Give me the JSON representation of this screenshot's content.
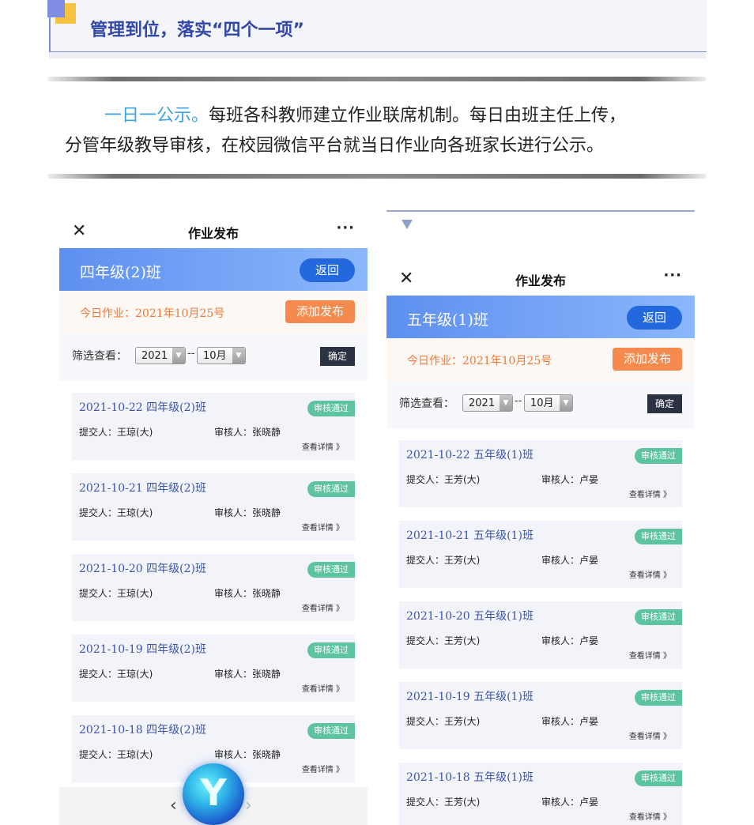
{
  "header": {
    "title": "管理到位，落实“四个一项”"
  },
  "intro": {
    "highlight": "一日一公示。",
    "line1_rest": "每班各科教师建立作业联席机制。每日由班主任上传，",
    "line2": "分管年级教导审核，在校园微信平台就当日作业向各班家长进行公示。"
  },
  "colors": {
    "accent_blue": "#3347a8",
    "class_bar": "#5d8ff0",
    "back_button": "#2368dc",
    "add_button": "#f48a4e",
    "approved_badge": "#5cc4a1"
  },
  "left_phone": {
    "close_icon": "✕",
    "title": "作业发布",
    "more_icon": "···",
    "class_name": "四年级(2)班",
    "back_label": "返回",
    "today": "今日作业：2021年10月25号",
    "add_label": "添加发布",
    "filter_label": "筛选查看：",
    "year": "2021",
    "dash": "--",
    "month": "10月",
    "confirm_label": "确定",
    "cards": [
      {
        "date": "2021-10-22 四年级(2)班",
        "status": "审核通过",
        "submitter": "提交人：王琼(大)",
        "reviewer": "审核人：张晓静",
        "detail": "查看详情 》"
      },
      {
        "date": "2021-10-21 四年级(2)班",
        "status": "审核通过",
        "submitter": "提交人：王琼(大)",
        "reviewer": "审核人：张晓静",
        "detail": "查看详情 》"
      },
      {
        "date": "2021-10-20 四年级(2)班",
        "status": "审核通过",
        "submitter": "提交人：王琼(大)",
        "reviewer": "审核人：张晓静",
        "detail": "查看详情 》"
      },
      {
        "date": "2021-10-19 四年级(2)班",
        "status": "审核通过",
        "submitter": "提交人：王琼(大)",
        "reviewer": "审核人：张晓静",
        "detail": "查看详情 》"
      },
      {
        "date": "2021-10-18 四年级(2)班",
        "status": "审核通过",
        "submitter": "提交人：王琼(大)",
        "reviewer": "审核人：张晓静",
        "detail": "查看详情 》"
      }
    ],
    "nav_prev": "‹",
    "nav_next": "›",
    "logo_glyph": "Y"
  },
  "right_phone": {
    "close_icon": "✕",
    "title": "作业发布",
    "more_icon": "···",
    "class_name": "五年级(1)班",
    "back_label": "返回",
    "today": "今日作业：2021年10月25号",
    "add_label": "添加发布",
    "filter_label": "筛选查看：",
    "year": "2021",
    "dash": "--",
    "month": "10月",
    "confirm_label": "确定",
    "cards": [
      {
        "date": "2021-10-22 五年级(1)班",
        "status": "审核通过",
        "submitter": "提交人：王芳(大)",
        "reviewer": "审核人：卢晏",
        "detail": "查看详情 》"
      },
      {
        "date": "2021-10-21 五年级(1)班",
        "status": "审核通过",
        "submitter": "提交人：王芳(大)",
        "reviewer": "审核人：卢晏",
        "detail": "查看详情 》"
      },
      {
        "date": "2021-10-20 五年级(1)班",
        "status": "审核通过",
        "submitter": "提交人：王芳(大)",
        "reviewer": "审核人：卢晏",
        "detail": "查看详情 》"
      },
      {
        "date": "2021-10-19 五年级(1)班",
        "status": "审核通过",
        "submitter": "提交人：王芳(大)",
        "reviewer": "审核人：卢晏",
        "detail": "查看详情 》"
      },
      {
        "date": "2021-10-18 五年级(1)班",
        "status": "审核通过",
        "submitter": "提交人：王芳(大)",
        "reviewer": "审核人：卢晏",
        "detail": "查看详情 》"
      }
    ]
  }
}
